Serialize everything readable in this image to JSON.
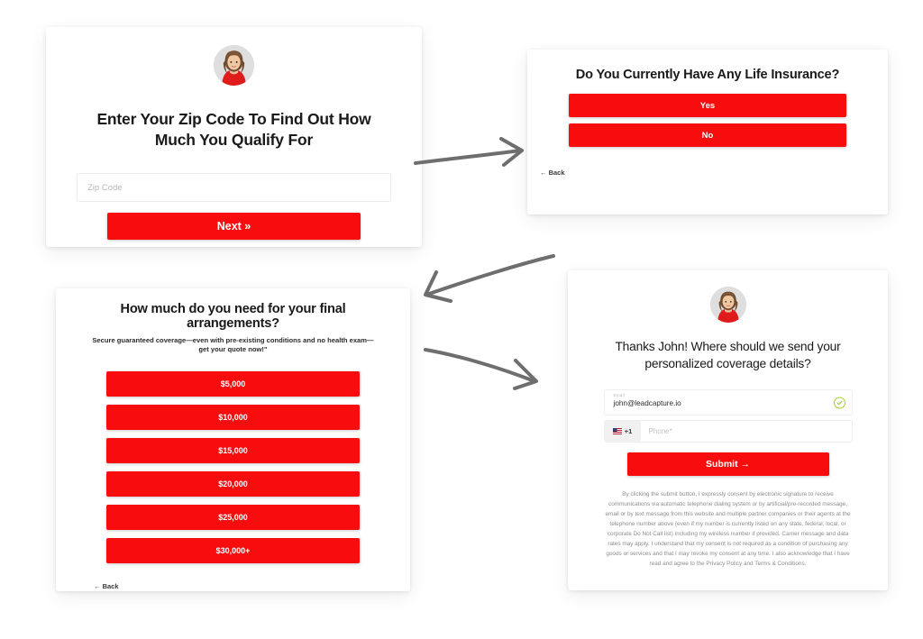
{
  "theme": {
    "accent_red": "#F70D0D",
    "background": "#FFFFFF",
    "card_background": "#FFFFFF"
  },
  "card_zip": {
    "avatar": "agent-avatar",
    "title": "Enter Your Zip Code To Find Out How Much You Qualify For",
    "zip_placeholder": "Zip Code",
    "zip_value": "",
    "next_label": "Next »"
  },
  "card_insurance": {
    "title": "Do You Currently Have Any Life Insurance?",
    "options": [
      {
        "label": "Yes"
      },
      {
        "label": "No"
      }
    ],
    "back_label": "← Back"
  },
  "card_amount": {
    "title": "How much do you need for your final arrangements?",
    "subtitle": "Secure guaranteed coverage—even with pre-existing conditions and no health exam—get your quote now!\"",
    "options": [
      {
        "label": "$5,000"
      },
      {
        "label": "$10,000"
      },
      {
        "label": "$15,000"
      },
      {
        "label": "$20,000"
      },
      {
        "label": "$25,000"
      },
      {
        "label": "$30,000+"
      }
    ],
    "back_label": "← Back"
  },
  "card_contact": {
    "avatar": "agent-avatar",
    "title": "Thanks John! Where should we send your personalized coverage details?",
    "email_label": "Email",
    "email_value": "john@leadcapture.io",
    "email_valid_icon": "check-circle-icon",
    "phone_country_code": "+1",
    "phone_flag": "us-flag-icon",
    "phone_placeholder": "Phone*",
    "phone_value": "",
    "submit_label": "Submit →",
    "legal_text": "By clicking the submit button, I expressly consent by electronic signature to receive communications via automatic telephone dialing system or by artificial/pre-recorded message, email or by text message from this website and multiple partner companies or their agents at the telephone number above (even if my number is currently listed on any state, federal, local, or corporate Do Not Call list) including my wireless number if provided. Carrier message and data rates may apply. I understand that my consent is not required as a condition of purchasing any goods or services and that I may revoke my consent at any time. I also acknowledge that I have read and agree to the Privacy Policy and Terms & Conditions."
  },
  "arrows": [
    {
      "name": "arrow-zip-to-insurance",
      "direction": "right"
    },
    {
      "name": "arrow-insurance-to-amount",
      "direction": "down-left"
    },
    {
      "name": "arrow-amount-to-contact",
      "direction": "down-right"
    }
  ]
}
